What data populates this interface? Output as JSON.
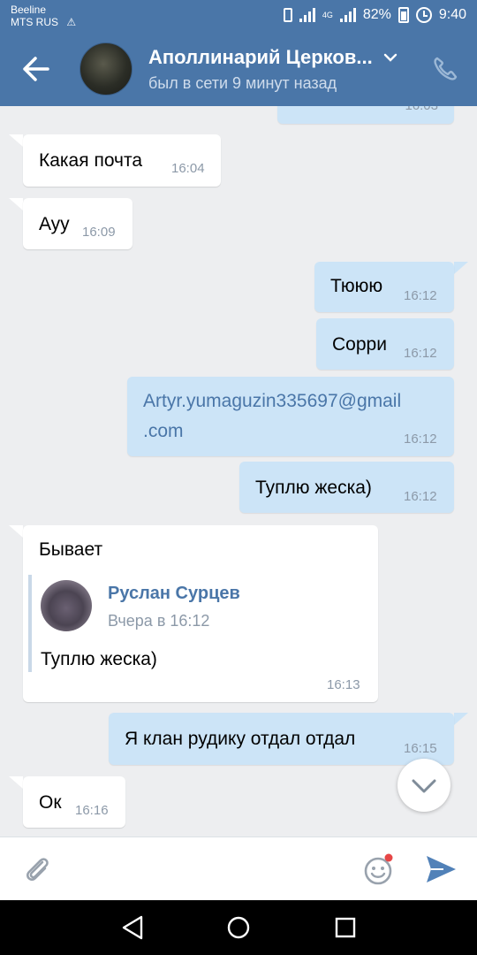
{
  "status_bar": {
    "carrier_1": "Beeline",
    "carrier_2": "MTS RUS",
    "network": "4G",
    "battery": "82%",
    "time": "9:40"
  },
  "header": {
    "name": "Аполлинарий Церков...",
    "status": "был в сети 9 минут назад",
    "back_icon": "arrow-left-icon",
    "menu_icon": "chevron-down-icon",
    "call_icon": "phone-icon"
  },
  "messages": [
    {
      "dir": "out",
      "text": "",
      "time": "16:03"
    },
    {
      "dir": "in",
      "text": "Какая почта",
      "time": "16:04"
    },
    {
      "dir": "in",
      "text": "Ayy",
      "time": "16:09"
    },
    {
      "dir": "out",
      "text": "Тююю",
      "time": "16:12"
    },
    {
      "dir": "out",
      "text": "Сорри",
      "time": "16:12"
    },
    {
      "dir": "out",
      "text_line1": "Artyr.yumaguzin335697@gmail",
      "text_line2": ".com",
      "time": "16:12"
    },
    {
      "dir": "out",
      "text": "Туплю жеска)",
      "time": "16:12"
    },
    {
      "dir": "in",
      "text": "Бывает",
      "time": "16:13",
      "forwarded": {
        "name": "Руслан Сурцев",
        "date": "Вчера в 16:12",
        "text": "Туплю жеска)"
      }
    },
    {
      "dir": "out",
      "text": "Я клан рудику отдал  отдал",
      "time": "16:15"
    },
    {
      "dir": "in",
      "text": "Ок",
      "time": "16:16"
    }
  ],
  "input_bar": {
    "attach_icon": "paperclip-icon",
    "emoji_icon": "smile-icon",
    "send_icon": "send-icon"
  },
  "colors": {
    "header": "#4a76a8",
    "outgoing_bubble": "#cce4f7",
    "incoming_bubble": "#ffffff",
    "background": "#edeef0",
    "link": "#4a76a8"
  }
}
